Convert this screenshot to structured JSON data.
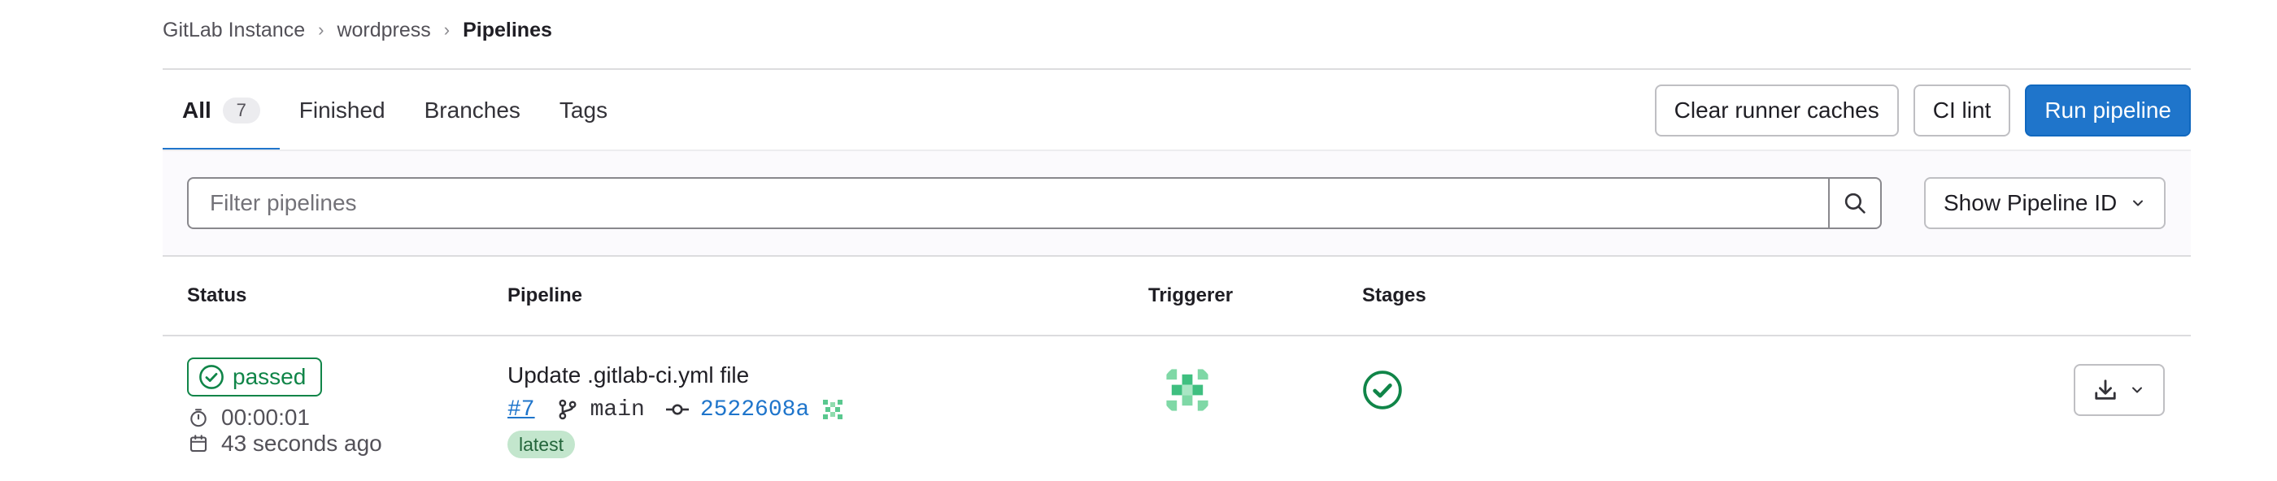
{
  "breadcrumb": [
    "GitLab Instance",
    "wordpress",
    "Pipelines"
  ],
  "tabs": [
    {
      "label": "All",
      "count": "7"
    },
    {
      "label": "Finished"
    },
    {
      "label": "Branches"
    },
    {
      "label": "Tags"
    }
  ],
  "actions": {
    "clear_caches": "Clear runner caches",
    "ci_lint": "CI lint",
    "run_pipeline": "Run pipeline"
  },
  "filter": {
    "placeholder": "Filter pipelines",
    "show_id": "Show Pipeline ID"
  },
  "table": {
    "headers": [
      "Status",
      "Pipeline",
      "Triggerer",
      "Stages"
    ],
    "rows": [
      {
        "status": "passed",
        "duration": "00:00:01",
        "finished": "43 seconds ago",
        "title": "Update .gitlab-ci.yml file",
        "id": "#7",
        "branch": "main",
        "sha": "2522608a",
        "badge": "latest"
      }
    ]
  },
  "colors": {
    "primary": "#1f75cb",
    "success": "#108548",
    "latest_bg": "#c3e6cd"
  }
}
